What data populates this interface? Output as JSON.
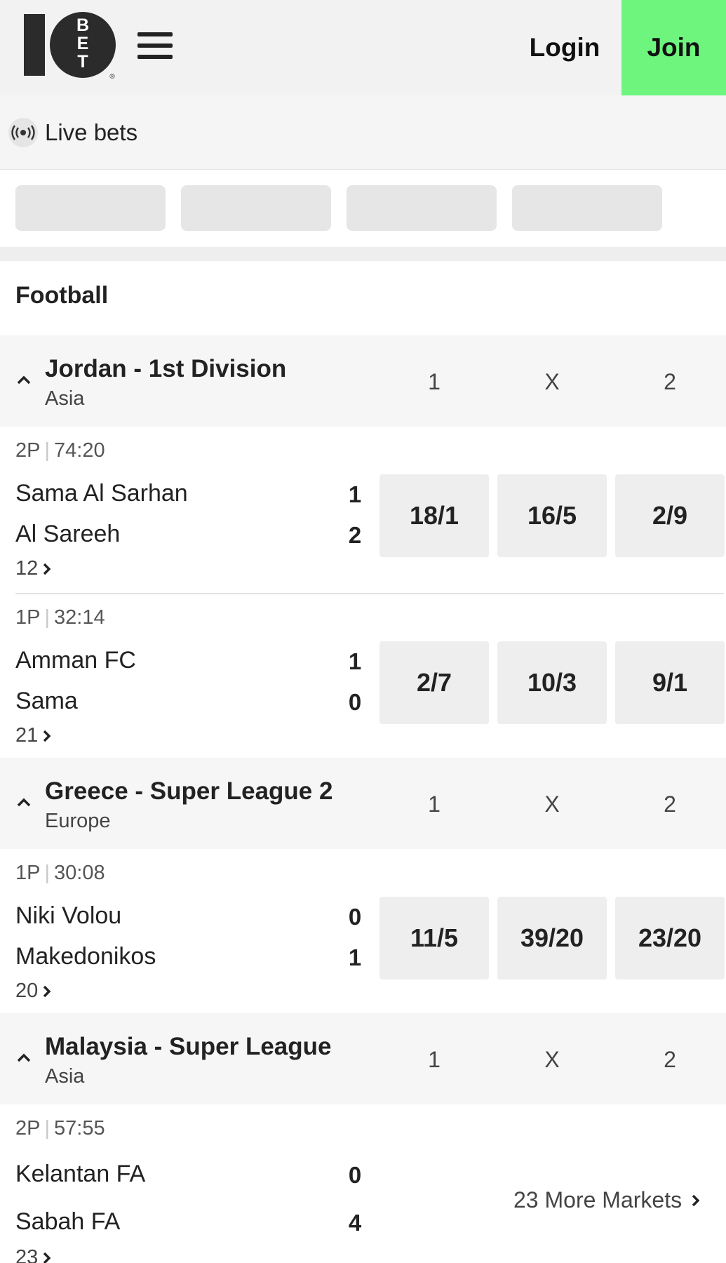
{
  "header": {
    "logo_text": "10BET",
    "login_label": "Login",
    "join_label": "Join"
  },
  "live": {
    "label": "Live bets"
  },
  "section": {
    "title": "Football"
  },
  "columns": {
    "home": "1",
    "draw": "X",
    "away": "2"
  },
  "leagues": [
    {
      "name": "Jordan - 1st Division",
      "region": "Asia",
      "matches": [
        {
          "period": "2P",
          "clock": "74:20",
          "home": "Sama Al Sarhan",
          "away": "Al Sareeh",
          "home_score": "1",
          "away_score": "2",
          "markets": "12",
          "odds": [
            "18/1",
            "16/5",
            "2/9"
          ]
        },
        {
          "period": "1P",
          "clock": "32:14",
          "home": "Amman FC",
          "away": "Sama",
          "home_score": "1",
          "away_score": "0",
          "markets": "21",
          "odds": [
            "2/7",
            "10/3",
            "9/1"
          ]
        }
      ]
    },
    {
      "name": "Greece - Super League 2",
      "region": "Europe",
      "matches": [
        {
          "period": "1P",
          "clock": "30:08",
          "home": "Niki Volou",
          "away": "Makedonikos",
          "home_score": "0",
          "away_score": "1",
          "markets": "20",
          "odds": [
            "11/5",
            "39/20",
            "23/20"
          ]
        }
      ]
    },
    {
      "name": "Malaysia - Super League",
      "region": "Asia",
      "matches": [
        {
          "period": "2P",
          "clock": "57:55",
          "home": "Kelantan FA",
          "away": "Sabah FA",
          "home_score": "0",
          "away_score": "4",
          "markets": "23",
          "more_markets": "23 More Markets"
        }
      ]
    }
  ],
  "colors": {
    "join": "#6ef57d",
    "header_bg": "#f2f2f2",
    "odds_bg": "#eeeeee"
  }
}
